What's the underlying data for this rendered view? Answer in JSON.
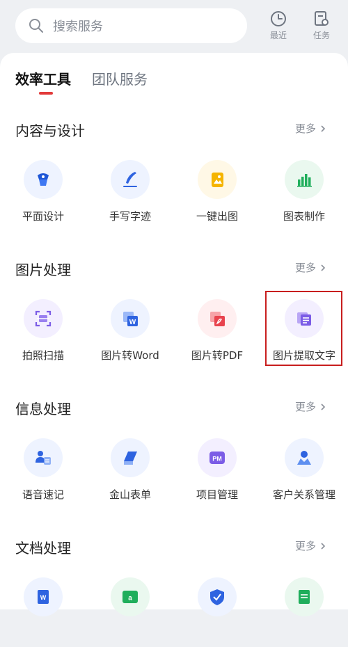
{
  "search": {
    "placeholder": "搜索服务"
  },
  "top_buttons": [
    {
      "label": "最近",
      "icon": "clock-icon"
    },
    {
      "label": "任务",
      "icon": "task-icon"
    }
  ],
  "tabs": [
    {
      "label": "效率工具",
      "active": true
    },
    {
      "label": "团队服务",
      "active": false
    }
  ],
  "more_label": "更多",
  "sections": [
    {
      "title": "内容与设计",
      "items": [
        {
          "label": "平面设计",
          "icon": "design-icon",
          "bg": "#eef3ff"
        },
        {
          "label": "手写字迹",
          "icon": "handwriting-icon",
          "bg": "#eef3ff"
        },
        {
          "label": "一键出图",
          "icon": "image-gen-icon",
          "bg": "#fff8e6"
        },
        {
          "label": "图表制作",
          "icon": "chart-icon",
          "bg": "#eaf8ef"
        }
      ]
    },
    {
      "title": "图片处理",
      "items": [
        {
          "label": "拍照扫描",
          "icon": "scan-icon",
          "bg": "#f3efff"
        },
        {
          "label": "图片转Word",
          "icon": "image-to-word-icon",
          "bg": "#eef3ff"
        },
        {
          "label": "图片转PDF",
          "icon": "image-to-pdf-icon",
          "bg": "#ffeff0"
        },
        {
          "label": "图片提取文字",
          "icon": "extract-text-icon",
          "bg": "#f3efff"
        }
      ]
    },
    {
      "title": "信息处理",
      "items": [
        {
          "label": "语音速记",
          "icon": "voice-note-icon",
          "bg": "#eef3ff"
        },
        {
          "label": "金山表单",
          "icon": "form-icon",
          "bg": "#eef3ff"
        },
        {
          "label": "项目管理",
          "icon": "project-icon",
          "bg": "#f3efff"
        },
        {
          "label": "客户关系管理",
          "icon": "crm-icon",
          "bg": "#eef3ff"
        }
      ]
    },
    {
      "title": "文档处理",
      "items": [
        {
          "label": "",
          "icon": "doc-word-icon",
          "bg": "#eef3ff"
        },
        {
          "label": "",
          "icon": "translate-icon",
          "bg": "#eaf8ef"
        },
        {
          "label": "",
          "icon": "check-icon",
          "bg": "#eef3ff"
        },
        {
          "label": "",
          "icon": "doc-green-icon",
          "bg": "#eaf8ef"
        }
      ]
    }
  ]
}
